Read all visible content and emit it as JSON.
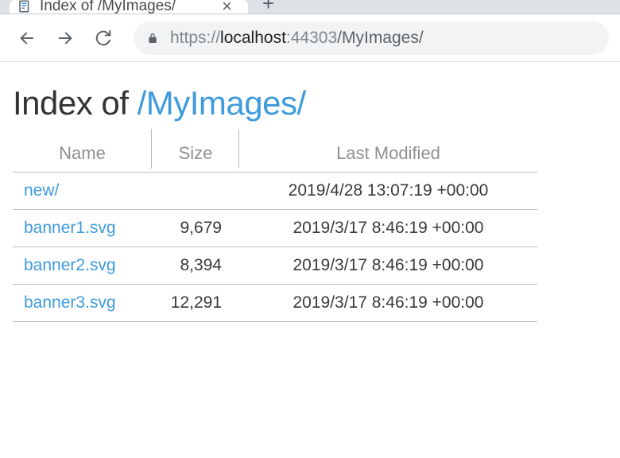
{
  "tab": {
    "title": "Index of /MyImages/"
  },
  "url": {
    "scheme": "https://",
    "host": "localhost",
    "port": ":44303",
    "path": "/MyImages/"
  },
  "heading": {
    "prefix": "Index of ",
    "path": "/MyImages/"
  },
  "table": {
    "headers": {
      "name": "Name",
      "size": "Size",
      "modified": "Last Modified"
    },
    "rows": [
      {
        "name": "new/",
        "size": "",
        "modified": "2019/4/28 13:07:19 +00:00"
      },
      {
        "name": "banner1.svg",
        "size": "9,679",
        "modified": "2019/3/17 8:46:19 +00:00"
      },
      {
        "name": "banner2.svg",
        "size": "8,394",
        "modified": "2019/3/17 8:46:19 +00:00"
      },
      {
        "name": "banner3.svg",
        "size": "12,291",
        "modified": "2019/3/17 8:46:19 +00:00"
      }
    ]
  }
}
